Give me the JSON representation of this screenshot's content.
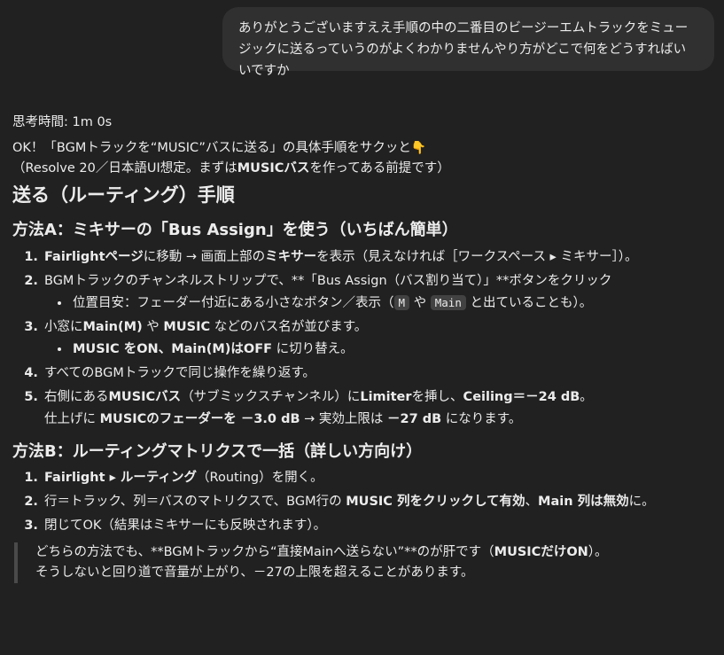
{
  "user_message": "ありがとうございますええ手順の中の二番目のビージーエムトラックをミュージックに送るっていうのがよくわかりませんやり方がどこで何をどうすればいいですか",
  "assistant": {
    "thinking_time": "思考時間: 1m 0s",
    "intro_line1": "OK！「BGMトラックを“MUSIC”バスに送る」の具体手順をサクッと",
    "intro_emoji": "👇",
    "intro_line2_a": "（Resolve 20／日本語UI想定。まずは",
    "intro_line2_b": "MUSICバス",
    "intro_line2_c": "を作ってある前提です）",
    "heading": "送る（ルーティング）手順",
    "methodA": {
      "title": "方法A：ミキサーの「Bus Assign」を使う（いちばん簡単）",
      "s1_a": "Fairlightページ",
      "s1_b": "に移動 → 画面上部の",
      "s1_c": "ミキサー",
      "s1_d": "を表示（見えなければ［ワークスペース ▸ ミキサー］）。",
      "s2": "BGMトラックのチャンネルストリップで、**「Bus Assign（バス割り当て）」**ボタンをクリック",
      "s2_sub_a": "位置目安：フェーダー付近にある小さなボタン／表示（",
      "s2_code1": "M",
      "s2_sub_b": " や ",
      "s2_code2": "Main",
      "s2_sub_c": " と出ていることも）。",
      "s3_a": "小窓に",
      "s3_b": "Main(M)",
      "s3_c": " や ",
      "s3_d": "MUSIC",
      "s3_e": " などのバス名が並びます。",
      "s3_sub_a": "MUSIC をON、Main(M)はOFF",
      "s3_sub_b": " に切り替え。",
      "s4": "すべてのBGMトラックで同じ操作を繰り返す。",
      "s5_a": "右側にある",
      "s5_b": "MUSICバス",
      "s5_c": "（サブミックスチャンネル）に",
      "s5_d": "Limiter",
      "s5_e": "を挿し、",
      "s5_f": "Ceiling＝－24 dB",
      "s5_g": "。",
      "s5_cont_a": "仕上げに ",
      "s5_cont_b": "MUSICのフェーダーを －3.0 dB",
      "s5_cont_c": " → 実効上限は ",
      "s5_cont_d": "－27 dB",
      "s5_cont_e": " になります。"
    },
    "methodB": {
      "title": "方法B：ルーティングマトリクスで一括（詳しい方向け）",
      "s1_a": "Fairlight ▸ ルーティング",
      "s1_b": "（Routing）を開く。",
      "s2_a": "行＝トラック、列＝バスのマトリクスで、BGM行の ",
      "s2_b": "MUSIC 列をクリックして有効",
      "s2_c": "、",
      "s2_d": "Main 列は無効",
      "s2_e": "に。",
      "s3": "閉じてOK（結果はミキサーにも反映されます）。"
    },
    "note_line1_a": "どちらの方法でも、**BGMトラックから“直接Mainへ送らない”**のが肝です（",
    "note_line1_b": "MUSICだけON",
    "note_line1_c": "）。",
    "note_line2": "そうしないと回り道で音量が上がり、－27の上限を超えることがあります。"
  }
}
